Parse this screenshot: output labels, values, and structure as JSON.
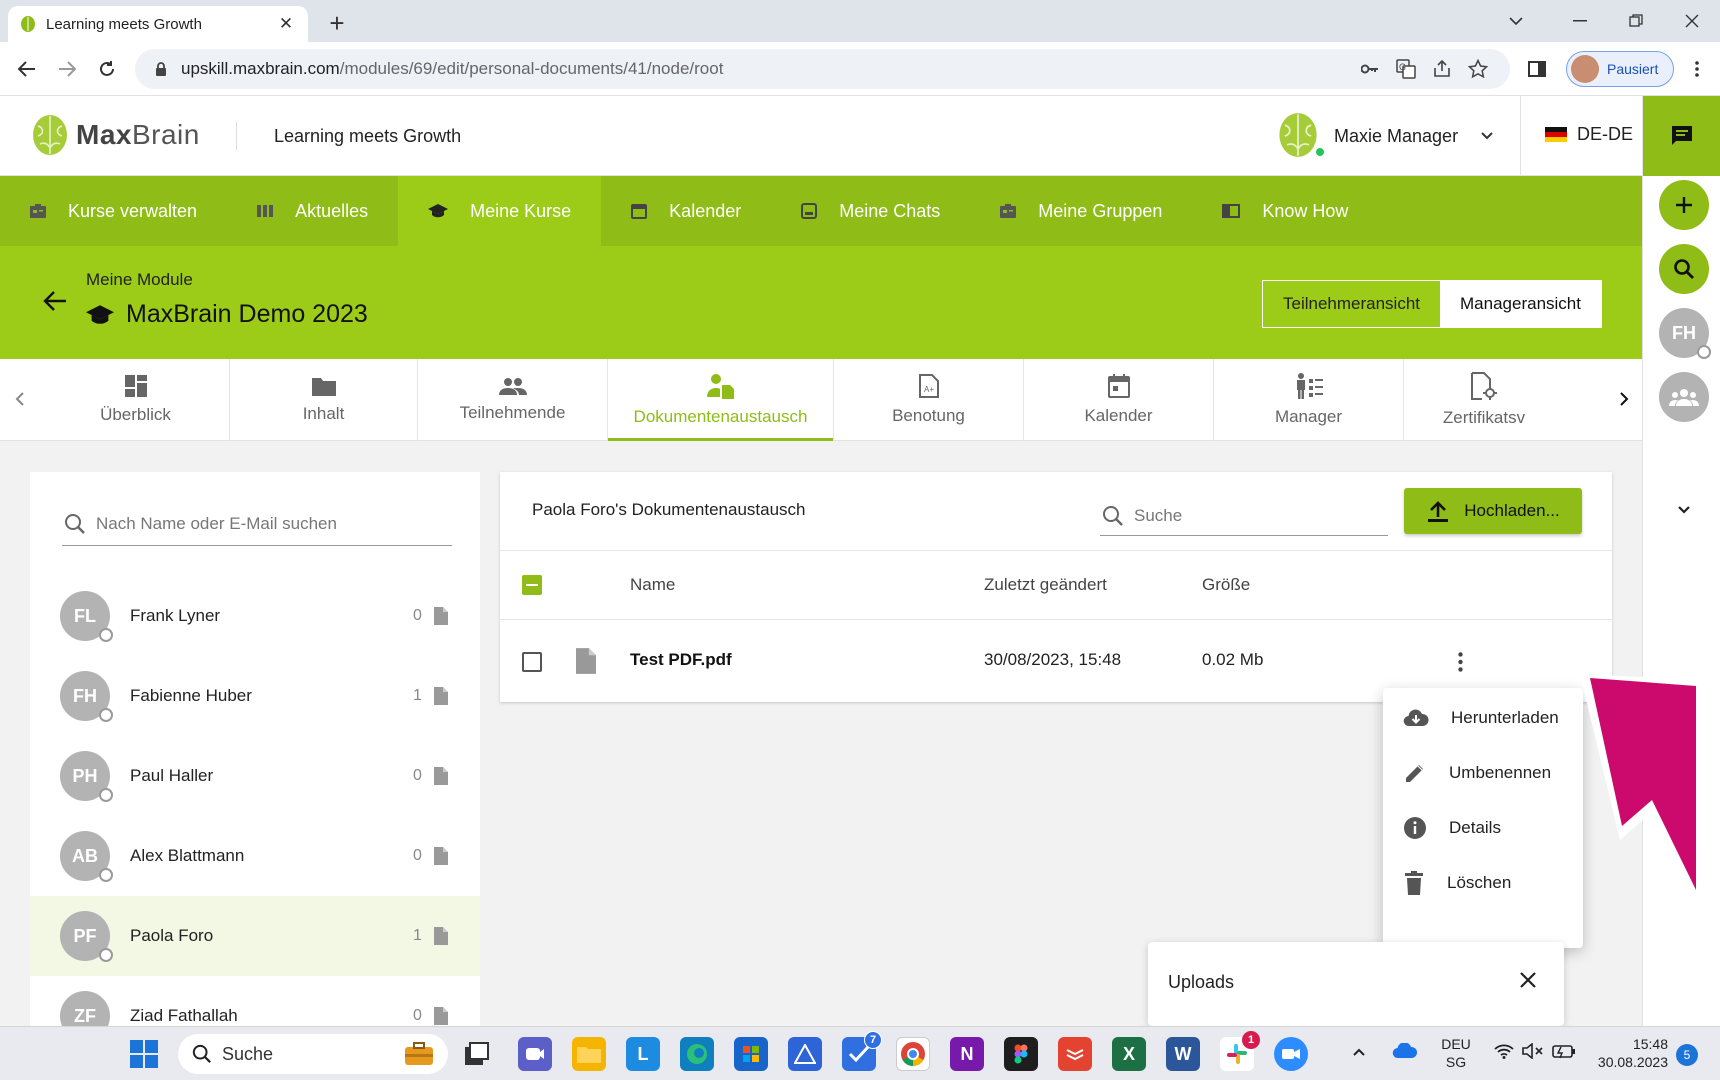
{
  "browser": {
    "tab_title": "Learning meets Growth",
    "url_host": "upskill.maxbrain.com",
    "url_path": "/modules/69/edit/personal-documents/41/node/root",
    "profile_label": "Pausiert"
  },
  "header": {
    "logo_max": "Max",
    "logo_brain": "Brain",
    "tagline": "Learning meets Growth",
    "user_name": "Maxie Manager",
    "language": "DE-DE"
  },
  "main_nav": [
    {
      "label": "Kurse verwalten",
      "icon": "course-manage-icon"
    },
    {
      "label": "Aktuelles",
      "icon": "news-icon"
    },
    {
      "label": "Meine Kurse",
      "icon": "graduation-cap-icon",
      "active": true
    },
    {
      "label": "Kalender",
      "icon": "calendar-icon"
    },
    {
      "label": "Meine Chats",
      "icon": "chat-icon"
    },
    {
      "label": "Meine Gruppen",
      "icon": "groups-icon"
    },
    {
      "label": "Know How",
      "icon": "book-icon"
    }
  ],
  "module": {
    "breadcrumb": "Meine Module",
    "title": "MaxBrain Demo 2023",
    "view_participant": "Teilnehmeransicht",
    "view_manager": "Manageransicht"
  },
  "module_tabs": [
    {
      "label": "Überblick",
      "icon": "dashboard-icon"
    },
    {
      "label": "Inhalt",
      "icon": "folder-icon"
    },
    {
      "label": "Teilnehmende",
      "icon": "people-icon"
    },
    {
      "label": "Dokumentenaustausch",
      "icon": "document-exchange-icon",
      "active": true
    },
    {
      "label": "Benotung",
      "icon": "grade-icon"
    },
    {
      "label": "Kalender",
      "icon": "calendar-icon"
    },
    {
      "label": "Manager",
      "icon": "manager-icon"
    },
    {
      "label": "Zertifikatsv",
      "icon": "certificate-icon"
    }
  ],
  "participants": {
    "search_placeholder": "Nach Name oder E-Mail suchen",
    "items": [
      {
        "initials": "FL",
        "name": "Frank Lyner",
        "count": "0"
      },
      {
        "initials": "FH",
        "name": "Fabienne Huber",
        "count": "1"
      },
      {
        "initials": "PH",
        "name": "Paul Haller",
        "count": "0"
      },
      {
        "initials": "AB",
        "name": "Alex Blattmann",
        "count": "0"
      },
      {
        "initials": "PF",
        "name": "Paola Foro",
        "count": "1",
        "selected": true
      },
      {
        "initials": "ZF",
        "name": "Ziad Fathallah",
        "count": "0"
      }
    ]
  },
  "documents": {
    "title": "Paola Foro's Dokumentenaustausch",
    "search_placeholder": "Suche",
    "upload_label": "Hochladen...",
    "columns": {
      "name": "Name",
      "modified": "Zuletzt geändert",
      "size": "Größe"
    },
    "rows": [
      {
        "name": "Test PDF.pdf",
        "modified": "30/08/2023, 15:48",
        "size": "0.02 Mb"
      }
    ]
  },
  "context_menu": [
    {
      "label": "Herunterladen",
      "icon": "cloud-download-icon"
    },
    {
      "label": "Umbenennen",
      "icon": "pencil-icon"
    },
    {
      "label": "Details",
      "icon": "info-icon"
    },
    {
      "label": "Löschen",
      "icon": "trash-icon"
    }
  ],
  "uploads": {
    "title": "Uploads"
  },
  "right_rail": {
    "avatar_initials": "FH"
  },
  "taskbar": {
    "search_label": "Suche",
    "lang_top": "DEU",
    "lang_bottom": "SG",
    "time": "15:48",
    "date": "30.08.2023",
    "notification_count": "5",
    "todo_badge": "7",
    "slack_badge": "1"
  },
  "colors": {
    "brand_green": "#8fbc16",
    "active_green": "#9ccc17",
    "arrow_magenta": "#cc0a6e"
  }
}
